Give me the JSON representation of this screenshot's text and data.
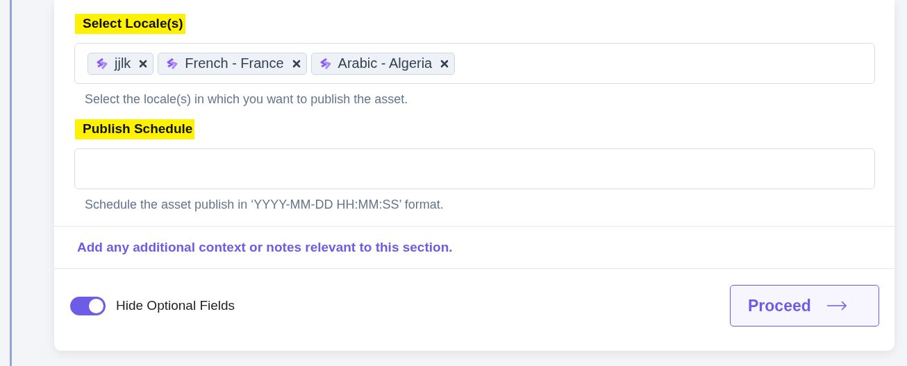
{
  "locale_field": {
    "label": "Select Locale(s)",
    "tags": [
      {
        "label": "jjlk"
      },
      {
        "label": "French - France"
      },
      {
        "label": "Arabic - Algeria"
      }
    ],
    "help": "Select the locale(s) in which you want to publish the asset."
  },
  "schedule_field": {
    "label": "Publish Schedule",
    "help": "Schedule the asset publish in ‘YYYY-MM-DD HH:MM:SS’ format."
  },
  "note": "Add any additional context or notes relevant to this section.",
  "toggle": {
    "label": "Hide Optional Fields",
    "on": true
  },
  "proceed_button": {
    "label": "Proceed"
  }
}
